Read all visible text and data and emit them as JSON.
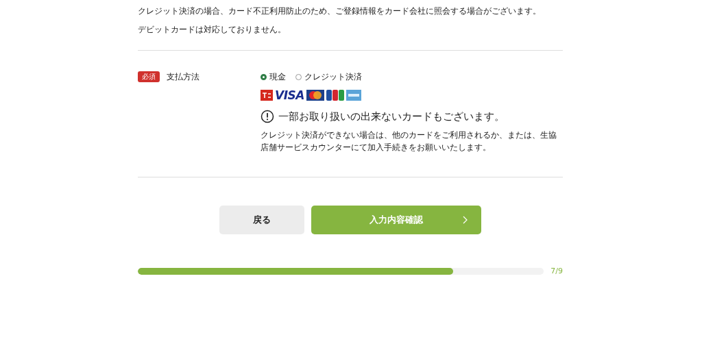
{
  "notes": [
    "クレジット決済の場合、カード不正利用防止のため、ご登録情報をカード会社に照会する場合がございます。",
    "デビットカードは対応しておりません。"
  ],
  "field": {
    "badge": "必須",
    "label": "支払方法",
    "options": [
      {
        "label": "現金",
        "selected": true
      },
      {
        "label": "クレジット決済",
        "selected": false
      }
    ],
    "cards": [
      {
        "kind": "ts3"
      },
      {
        "kind": "visa",
        "text": "VISA"
      },
      {
        "kind": "master"
      },
      {
        "kind": "jcb"
      },
      {
        "kind": "amex"
      }
    ],
    "warning": "一部お取り扱いの出来ないカードもございます。",
    "warning_note": "クレジット決済ができない場合は、他のカードをご利用されるか、または、生協店舗サービスカウンターにて加入手続きをお願いいたします。"
  },
  "buttons": {
    "back": "戻る",
    "next": "入力内容確認"
  },
  "progress": {
    "level": 0.7778,
    "text": "7/9"
  }
}
